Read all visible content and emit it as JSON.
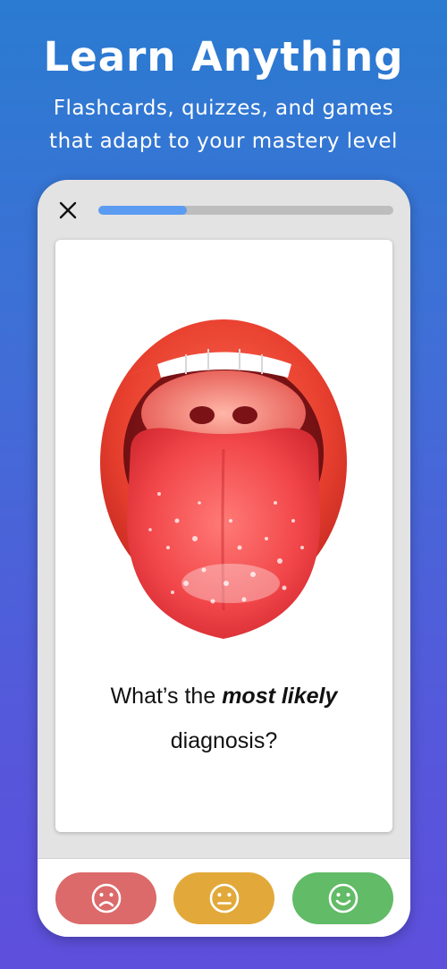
{
  "hero": {
    "title": "Learn Anything",
    "subtitle_line1": "Flashcards, quizzes, and games",
    "subtitle_line2": "that adapt to your mastery level"
  },
  "session": {
    "close_icon": "close-icon",
    "progress_fraction": 0.3,
    "progress_color": "#5b9cf2"
  },
  "card": {
    "image_subject": "tongue with white patches",
    "question_part1": "What’s the ",
    "question_emphasis": "most likely",
    "question_part2": "diagnosis?"
  },
  "ratings": [
    {
      "icon": "sad-face-icon",
      "color": "#dc6a6a"
    },
    {
      "icon": "neutral-face-icon",
      "color": "#e2a93a"
    },
    {
      "icon": "happy-face-icon",
      "color": "#62bb67"
    }
  ],
  "colors": {
    "background_top": "#2a7bd1",
    "background_bottom": "#5e4fdc"
  }
}
